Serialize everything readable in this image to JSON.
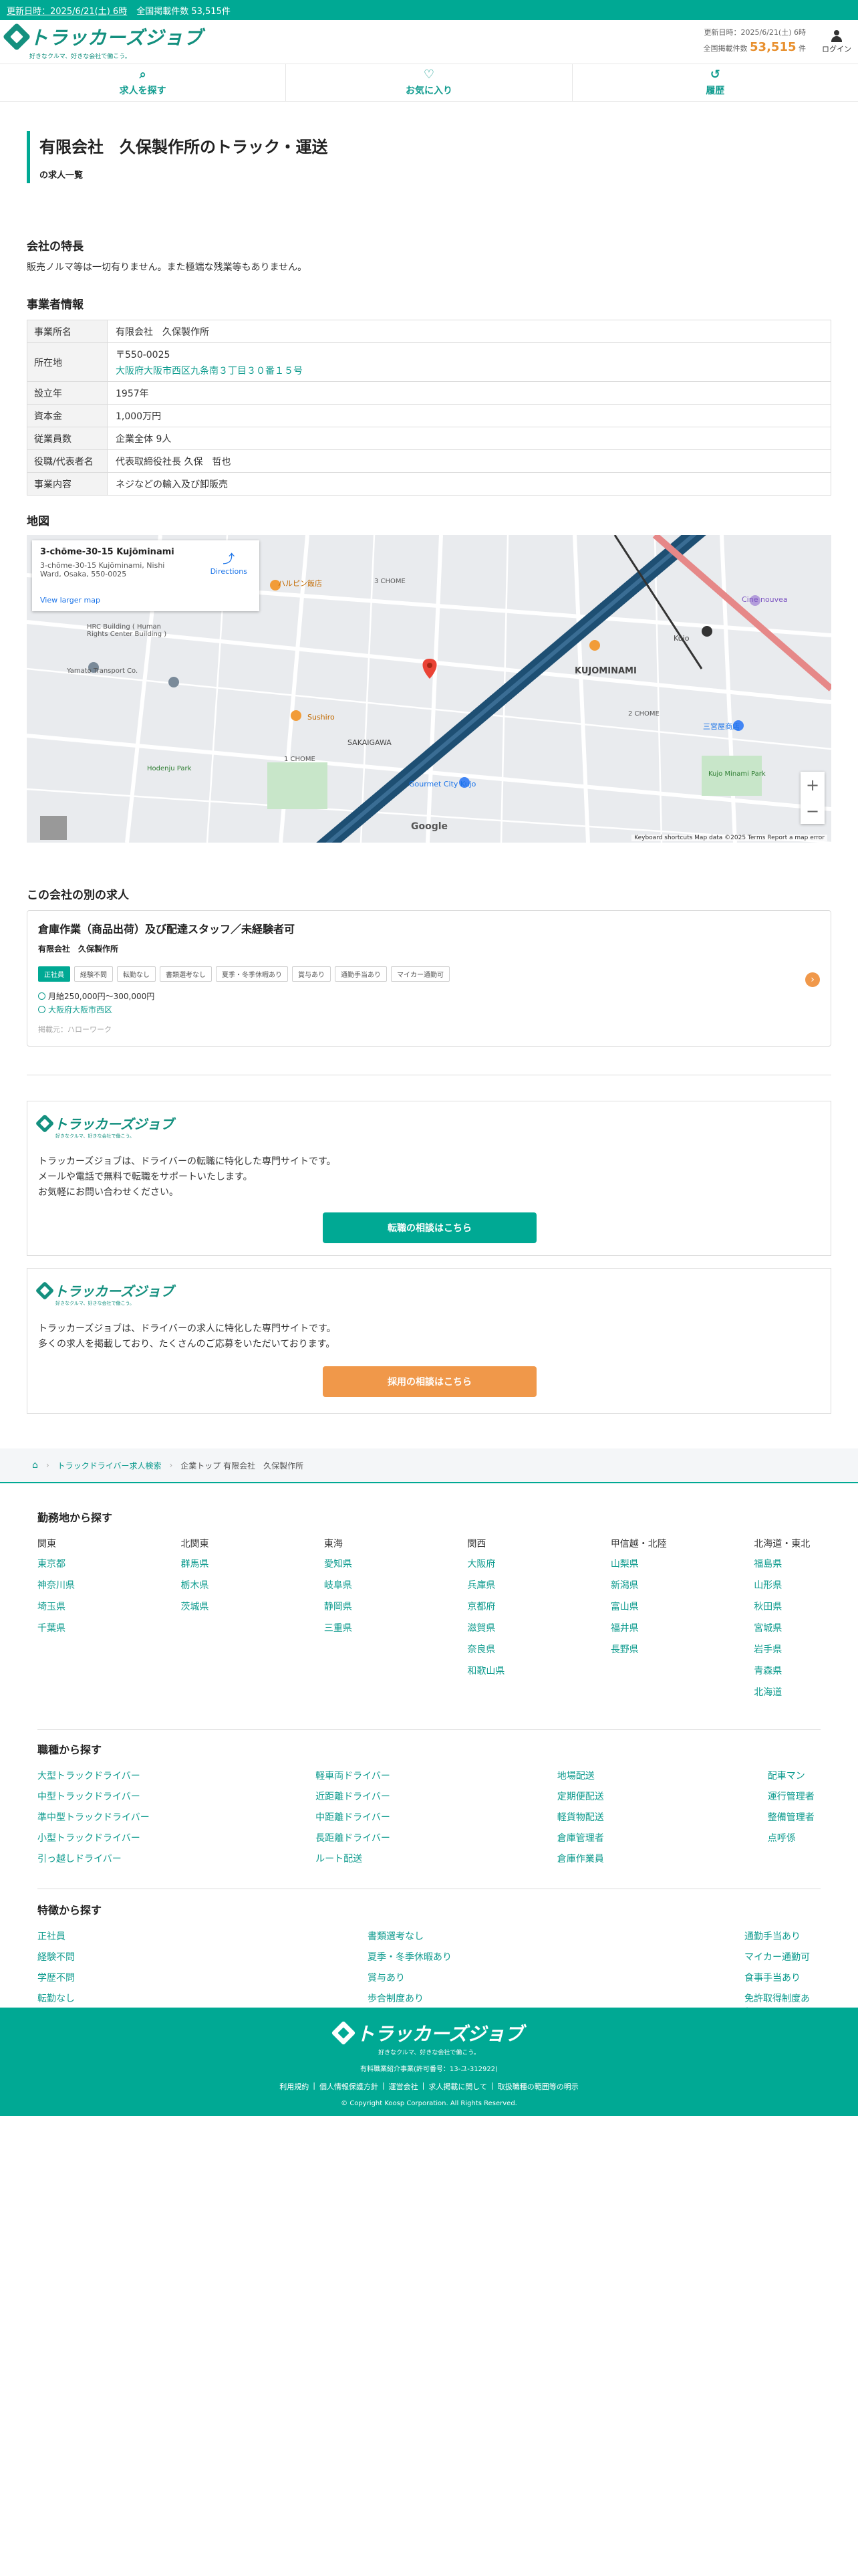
{
  "topbar": {
    "updated": "更新日時：2025/6/21(土) 6時",
    "total": "全国掲載件数 53,515件"
  },
  "header": {
    "logo": "トラッカーズジョブ",
    "tagline": "好きなクルマ、好きな会社で働こう。",
    "updated": "更新日時：2025/6/21(土) 6時",
    "count_label": "全国掲載件数",
    "count": "53,515",
    "count_unit": "件",
    "login": "ログイン"
  },
  "nav": [
    {
      "label": "求人を探す",
      "icon": "search-icon"
    },
    {
      "label": "お気に入り",
      "icon": "heart-icon"
    },
    {
      "label": "履歴",
      "icon": "history-icon"
    }
  ],
  "page": {
    "title": "有限会社　久保製作所のトラック・運送",
    "subtitle": "の求人一覧"
  },
  "features": {
    "heading": "会社の特長",
    "text": "販売ノルマ等は一切有りません。また極端な残業等もありません。"
  },
  "business": {
    "heading": "事業者情報",
    "rows": [
      {
        "label": "事業所名",
        "value": "有限会社　久保製作所"
      },
      {
        "label": "所在地",
        "value": "〒550-0025",
        "link": "大阪府大阪市西区九条南３丁目３０番１５号"
      },
      {
        "label": "設立年",
        "value": "1957年"
      },
      {
        "label": "資本金",
        "value": "1,000万円"
      },
      {
        "label": "従業員数",
        "value": "企業全体 9人"
      },
      {
        "label": "役職/代表者名",
        "value": "代表取締役社長 久保　哲也"
      },
      {
        "label": "事業内容",
        "value": "ネジなどの輸入及び卸販売"
      }
    ]
  },
  "map": {
    "heading": "地図",
    "card_title": "3-chōme-30-15 Kujōminami",
    "card_address": "3-chōme-30-15 Kujōminami, Nishi Ward, Osaka, 550-0025",
    "card_link": "View larger map",
    "directions": "Directions",
    "zoom_in": "+",
    "zoom_out": "−",
    "attribution": "Keyboard shortcuts   Map data ©2025   Terms   Report a map error",
    "google": "Google",
    "labels": [
      "ハルピン飯店",
      "3 CHOME",
      "HRC Building ( Human Rights Center Building )",
      "Yamato Transport Co.",
      "KUJOMINAMI",
      "Sushiro",
      "SAKAIGAWA",
      "1 CHOME",
      "Gourmet City Kujo",
      "Kujo Minami Park",
      "Hodenju Park",
      "Cine nouvea",
      "三宮屋商店",
      "2 CHOME",
      "Kujo"
    ]
  },
  "other": {
    "heading": "この会社の別の求人",
    "job": {
      "title": "倉庫作業（商品出荷）及び配達スタッフ／未経験者可",
      "company": "有限会社　久保製作所",
      "tags": [
        "正社員",
        "経験不問",
        "転勤なし",
        "書類選考なし",
        "夏季・冬季休暇あり",
        "賞与あり",
        "通勤手当あり",
        "マイカー通勤可"
      ],
      "salary": "月給250,000円〜300,000円",
      "location": "大阪府大阪市西区",
      "updated": "掲載元：ハローワーク"
    }
  },
  "promo1": {
    "logo": "トラッカーズジョブ",
    "tagline": "好きなクルマ、好きな会社で働こう。",
    "lines": [
      "トラッカーズジョブは、ドライバーの転職に特化した専門サイトです。",
      "メールや電話で無料で転職をサポートいたします。",
      "お気軽にお問い合わせください。"
    ],
    "button": "転職の相談はこちら"
  },
  "promo2": {
    "logo": "トラッカーズジョブ",
    "tagline": "好きなクルマ、好きな会社で働こう。",
    "lines": [
      "トラッカーズジョブは、ドライバーの求人に特化した専門サイトです。",
      "多くの求人を掲載しており、たくさんのご応募をいただいております。"
    ],
    "button": "採用の相談はこちら"
  },
  "breadcrumb": {
    "home": "⌂",
    "level1": "トラックドライバー求人検索",
    "current": "企業トップ 有限会社　久保製作所"
  },
  "by_region": {
    "heading": "勤務地から探す",
    "regions": [
      {
        "name": "関東",
        "prefs": [
          "東京都",
          "神奈川県",
          "埼玉県",
          "千葉県"
        ]
      },
      {
        "name": "北関東",
        "prefs": [
          "群馬県",
          "栃木県",
          "茨城県"
        ]
      },
      {
        "name": "東海",
        "prefs": [
          "愛知県",
          "岐阜県",
          "静岡県",
          "三重県"
        ]
      },
      {
        "name": "関西",
        "prefs": [
          "大阪府",
          "兵庫県",
          "京都府",
          "滋賀県",
          "奈良県",
          "和歌山県"
        ]
      },
      {
        "name": "甲信越・北陸",
        "prefs": [
          "山梨県",
          "新潟県",
          "富山県",
          "福井県",
          "長野県"
        ]
      },
      {
        "name": "北海道・東北",
        "prefs": [
          "福島県",
          "山形県",
          "秋田県",
          "宮城県",
          "岩手県",
          "青森県",
          "北海道"
        ]
      }
    ]
  },
  "by_job": {
    "heading": "職種から探す",
    "cols": [
      [
        "大型トラックドライバー",
        "中型トラックドライバー",
        "準中型トラックドライバー",
        "小型トラックドライバー",
        "引っ越しドライバー"
      ],
      [
        "軽車両ドライバー",
        "近距離ドライバー",
        "中距離ドライバー",
        "長距離ドライバー",
        "ルート配送"
      ],
      [
        "地場配送",
        "定期便配送",
        "軽貨物配送",
        "倉庫管理者",
        "倉庫作業員"
      ],
      [
        "配車マン",
        "運行管理者",
        "整備管理者",
        "点呼係"
      ]
    ]
  },
  "by_feature": {
    "heading": "特徴から探す",
    "cols": [
      [
        "正社員",
        "経験不問",
        "学歴不問",
        "転勤なし"
      ],
      [
        "書類選考なし",
        "夏季・冬季休暇あり",
        "賞与あり",
        "歩合制度あり"
      ],
      [
        "通勤手当あり",
        "マイカー通勤可",
        "食事手当あり",
        "免許取得制度あり"
      ]
    ]
  },
  "footer": {
    "logo": "トラッカーズジョブ",
    "tagline": "好きなクルマ、好きな会社で働こう。",
    "license": "有料職業紹介事業(許可番号：13-ユ-312922)",
    "links": [
      "利用規約",
      "個人情報保護方針",
      "運営会社",
      "求人掲載に関して",
      "取扱職種の範囲等の明示"
    ],
    "copyright": "© Copyright Koosp Corporation. All Rights Reserved."
  },
  "colors": {
    "brand": "#00a994",
    "link": "#0e9b8e",
    "accent": "#f0984a"
  }
}
